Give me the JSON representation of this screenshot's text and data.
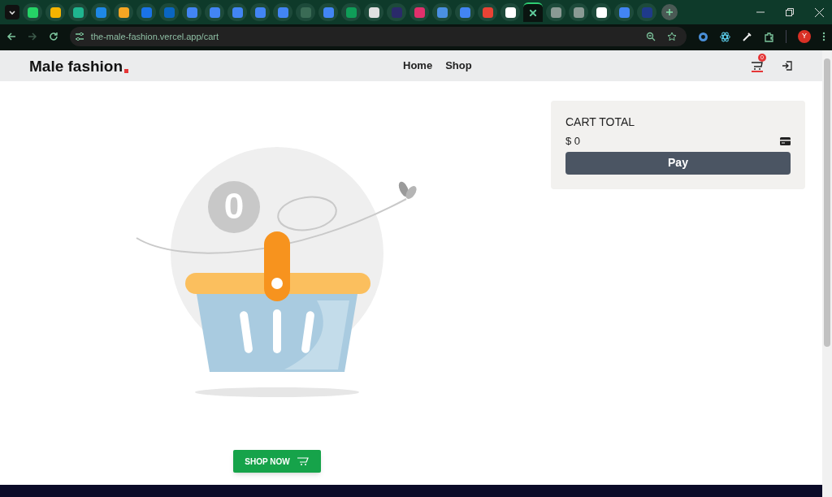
{
  "browser": {
    "tabs": [
      {
        "selected": false,
        "color": "#25d366"
      },
      {
        "selected": false,
        "color": "#f4b400"
      },
      {
        "selected": false,
        "color": "#1fb58f"
      },
      {
        "selected": false,
        "color": "#1e88e5"
      },
      {
        "selected": false,
        "color": "#f5a623"
      },
      {
        "selected": false,
        "color": "#1a73e8"
      },
      {
        "selected": false,
        "color": "#0a66c2"
      },
      {
        "selected": false,
        "color": "#4285f4"
      },
      {
        "selected": false,
        "color": "#4285f4"
      },
      {
        "selected": false,
        "color": "#4285f4"
      },
      {
        "selected": false,
        "color": "#4285f4"
      },
      {
        "selected": false,
        "color": "#4285f4"
      },
      {
        "selected": false,
        "color": "#3a6b55"
      },
      {
        "selected": false,
        "color": "#4285f4"
      },
      {
        "selected": false,
        "color": "#0f9d58"
      },
      {
        "selected": false,
        "color": "#e0e0e0"
      },
      {
        "selected": false,
        "color": "#2a2a6a"
      },
      {
        "selected": false,
        "color": "#e1306c"
      },
      {
        "selected": false,
        "color": "#4a90e2"
      },
      {
        "selected": false,
        "color": "#4285f4"
      },
      {
        "selected": false,
        "color": "#ea4335"
      },
      {
        "selected": false,
        "color": "#ffffff"
      },
      {
        "selected": true,
        "color": "#5fc99a"
      },
      {
        "selected": false,
        "color": "#8a9a94"
      },
      {
        "selected": false,
        "color": "#8a9a94"
      },
      {
        "selected": false,
        "color": "#ffffff"
      },
      {
        "selected": false,
        "color": "#4285f4"
      },
      {
        "selected": false,
        "color": "#1f3a8a"
      }
    ],
    "url": "the-male-fashion.vercel.app/cart",
    "avatar": "Y"
  },
  "header": {
    "logo": "Male fashion",
    "nav": [
      {
        "label": "Home"
      },
      {
        "label": "Shop"
      }
    ],
    "cart_count": "0"
  },
  "empty_cart": {
    "bubble": "0",
    "button": "SHOP NOW"
  },
  "cart_total": {
    "title": "CART TOTAL",
    "amount": "$ 0",
    "button": "Pay"
  }
}
